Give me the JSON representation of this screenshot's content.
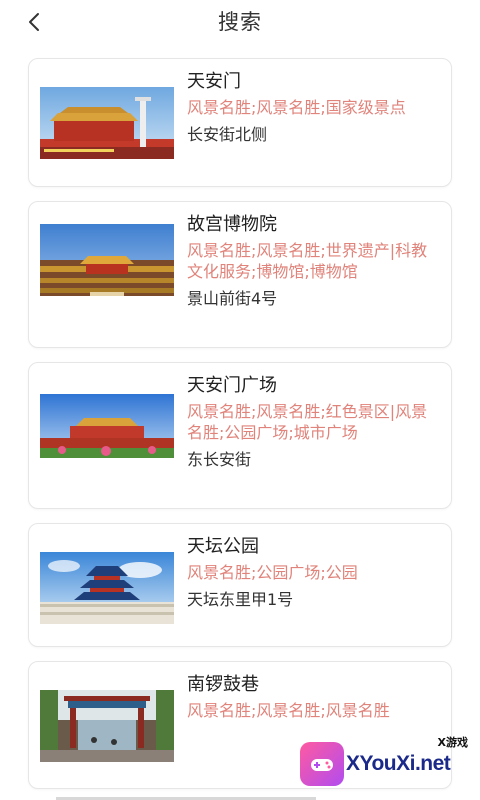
{
  "header": {
    "title": "搜索",
    "back_icon": "chevron-left-icon"
  },
  "results": [
    {
      "name": "天安门",
      "tags": "风景名胜;风景名胜;国家级景点",
      "address": "长安街北侧",
      "thumb": "tiananmen-photo"
    },
    {
      "name": "故宫博物院",
      "tags": "风景名胜;风景名胜;世界遗产|科教文化服务;博物馆;博物馆",
      "address": "景山前街4号",
      "thumb": "forbidden-city-photo"
    },
    {
      "name": "天安门广场",
      "tags": "风景名胜;风景名胜;红色景区|风景名胜;公园广场;城市广场",
      "address": "东长安街",
      "thumb": "tiananmen-square-photo"
    },
    {
      "name": "天坛公园",
      "tags": "风景名胜;公园广场;公园",
      "address": "天坛东里甲1号",
      "thumb": "temple-of-heaven-photo"
    },
    {
      "name": "南锣鼓巷",
      "tags": "风景名胜;风景名胜;风景名胜",
      "address": "",
      "thumb": "nanluoguxiang-photo"
    }
  ],
  "watermark": {
    "small": "X游戏",
    "main": "XYouXi.net"
  },
  "colors": {
    "tag": "#e0837a",
    "title": "#333333",
    "card_border": "#e6e6e6"
  }
}
